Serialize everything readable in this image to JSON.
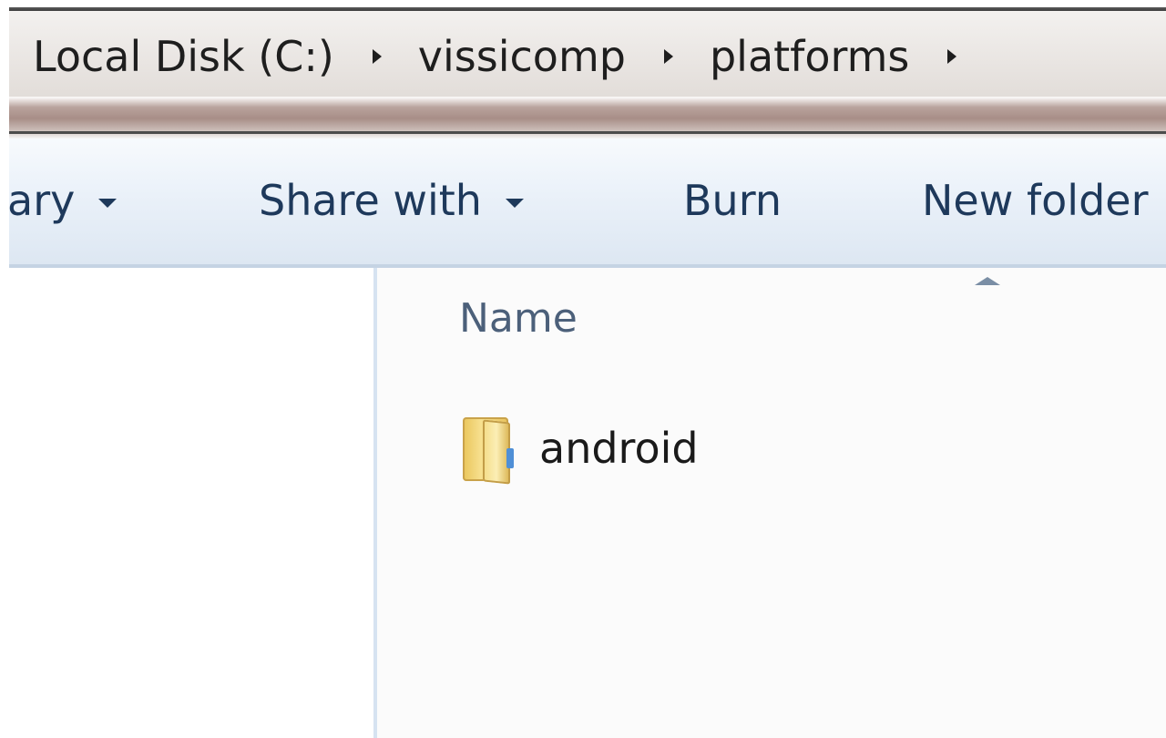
{
  "breadcrumb": {
    "items": [
      "Local Disk (C:)",
      "vissicomp",
      "platforms"
    ]
  },
  "toolbar": {
    "library_label": "ary",
    "share_label": "Share with",
    "burn_label": "Burn",
    "new_folder_label": "New folder"
  },
  "file_list": {
    "columns": {
      "name": "Name"
    },
    "items": [
      {
        "name": "android",
        "icon": "folder-icon"
      }
    ]
  },
  "colors": {
    "toolbar_text": "#1e395b",
    "header_text": "#4c607a",
    "splitter": "#d6e3f1"
  }
}
